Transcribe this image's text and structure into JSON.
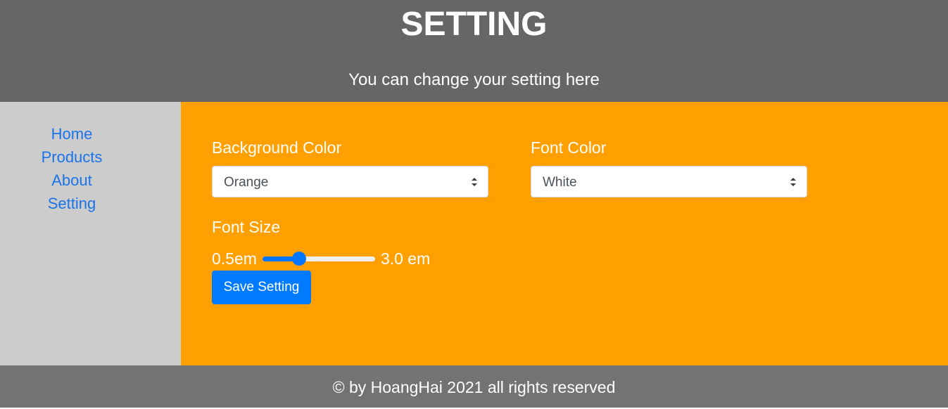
{
  "header": {
    "title": "SETTING",
    "subtitle": "You can change your setting here"
  },
  "sidebar": {
    "items": [
      {
        "label": "Home"
      },
      {
        "label": "Products"
      },
      {
        "label": "About"
      },
      {
        "label": "Setting"
      }
    ]
  },
  "settings": {
    "background_color": {
      "label": "Background Color",
      "value": "Orange"
    },
    "font_color": {
      "label": "Font Color",
      "value": "White"
    },
    "font_size": {
      "label": "Font Size",
      "min_label": "0.5em",
      "max_label": "3.0 em",
      "slider_fraction": 0.3
    },
    "save_label": "Save Setting"
  },
  "footer": {
    "text": "© by HoangHai 2021 all rights reserved"
  },
  "colors": {
    "header_bg": "#666666",
    "sidebar_bg": "#cccccc",
    "main_bg": "#ffa000",
    "footer_bg": "#737373",
    "link": "#1a73e8",
    "accent": "#007bff"
  }
}
